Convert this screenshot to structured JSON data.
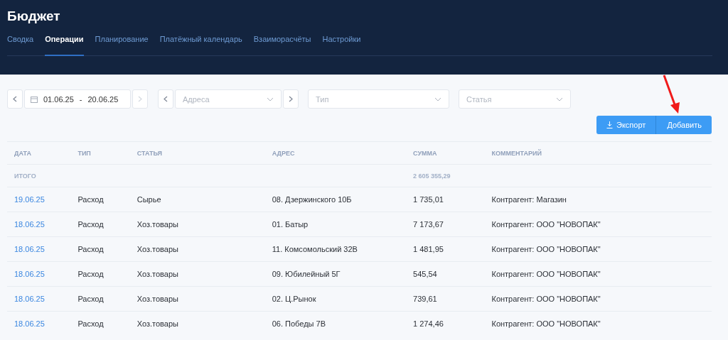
{
  "header": {
    "title": "Бюджет"
  },
  "tabs": [
    {
      "label": "Сводка",
      "selected": false
    },
    {
      "label": "Операции",
      "selected": true
    },
    {
      "label": "Планирование",
      "selected": false
    },
    {
      "label": "Платёжный календарь",
      "selected": false
    },
    {
      "label": "Взаиморасчёты",
      "selected": false
    },
    {
      "label": "Настройки",
      "selected": false
    }
  ],
  "filters": {
    "period": {
      "from": "01.06.25",
      "separator": "-",
      "to": "20.06.25",
      "prev_disabled": false,
      "next_disabled": true
    },
    "address": {
      "placeholder": "Адреса"
    },
    "type": {
      "placeholder": "Тип"
    },
    "article": {
      "placeholder": "Статья"
    }
  },
  "actions": [
    "Экспорт",
    "Добавить"
  ],
  "table": {
    "columns": [
      "ДАТА",
      "ТИП",
      "СТАТЬЯ",
      "АДРЕС",
      "СУММА",
      "КОММЕНТАРИЙ"
    ],
    "total": {
      "label": "ИТОГО",
      "sum": "2 605 355,29"
    },
    "rows": [
      [
        "19.06.25",
        "Расход",
        "Сырье",
        "08. Дзержинского 10Б",
        "1 735,01",
        "Контрагент: Магазин"
      ],
      [
        "18.06.25",
        "Расход",
        "Хоз.товары",
        "01. Батыр",
        "7 173,67",
        "Контрагент: ООО \"НОВОПАК\""
      ],
      [
        "18.06.25",
        "Расход",
        "Хоз.товары",
        "11. Комсомольский 32В",
        "1 481,95",
        "Контрагент: ООО \"НОВОПАК\""
      ],
      [
        "18.06.25",
        "Расход",
        "Хоз.товары",
        "09. Юбилейный 5Г",
        "545,54",
        "Контрагент: ООО \"НОВОПАК\""
      ],
      [
        "18.06.25",
        "Расход",
        "Хоз.товары",
        "02. Ц.Рынок",
        "739,61",
        "Контрагент: ООО \"НОВОПАК\""
      ],
      [
        "18.06.25",
        "Расход",
        "Хоз.товары",
        "06. Победы 7В",
        "1 274,46",
        "Контрагент: ООО \"НОВОПАК\""
      ]
    ]
  }
}
